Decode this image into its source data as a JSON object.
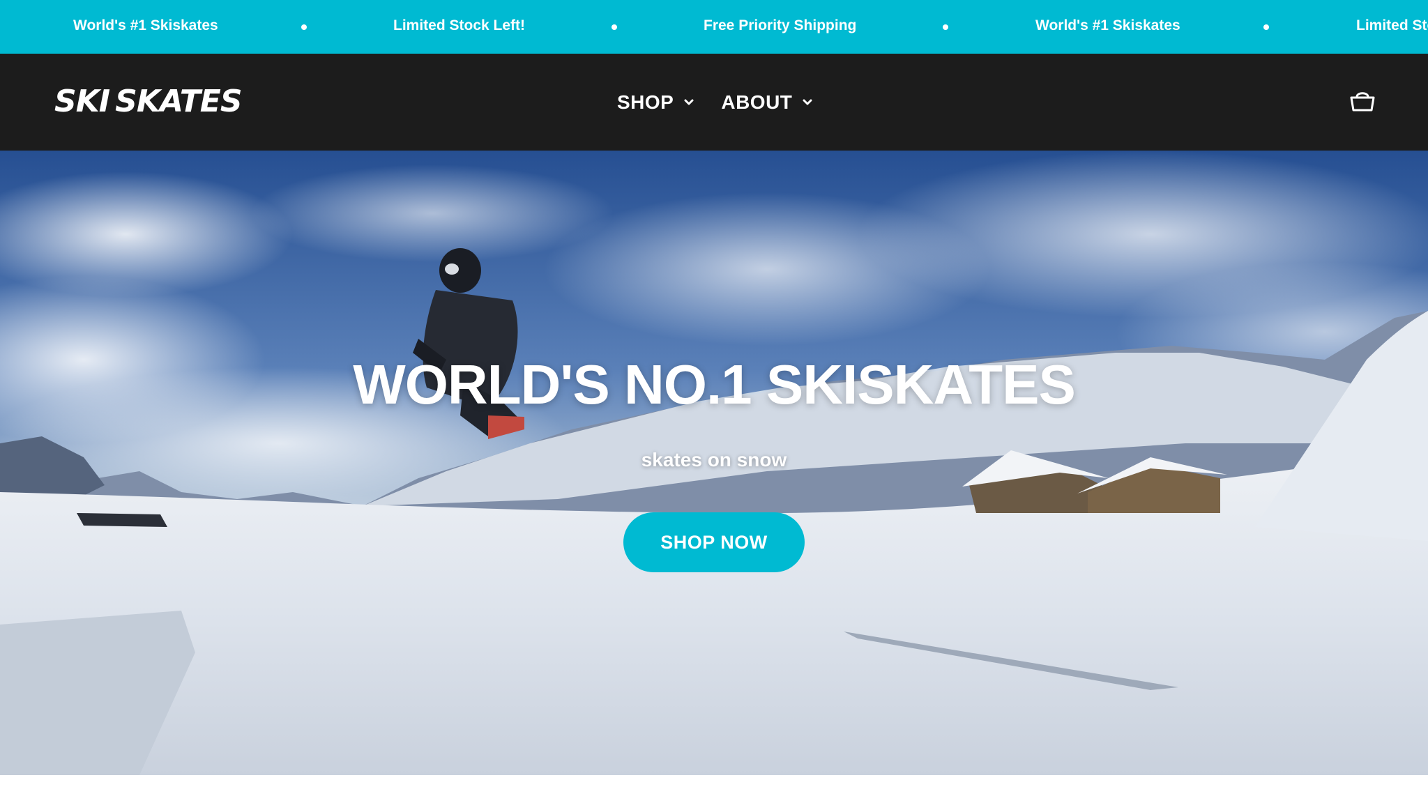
{
  "announcement": {
    "items": [
      "World's #1 Skiskates",
      "Limited Stock Left!",
      "Free Priority Shipping",
      "World's #1 Skiskates",
      "Limited Stock Left!"
    ],
    "color": "#00bad2"
  },
  "header": {
    "logo_part1": "SKI",
    "logo_part2": "SKATES",
    "nav": [
      {
        "label": "SHOP",
        "icon": "chevron-down-icon"
      },
      {
        "label": "ABOUT",
        "icon": "chevron-down-icon"
      }
    ],
    "cart_icon": "basket-icon",
    "background": "#1c1c1c"
  },
  "hero": {
    "title": "WORLD'S NO.1 SKISKATES",
    "subtitle": "skates on snow",
    "cta_label": "SHOP NOW",
    "cta_color": "#00bad2"
  }
}
